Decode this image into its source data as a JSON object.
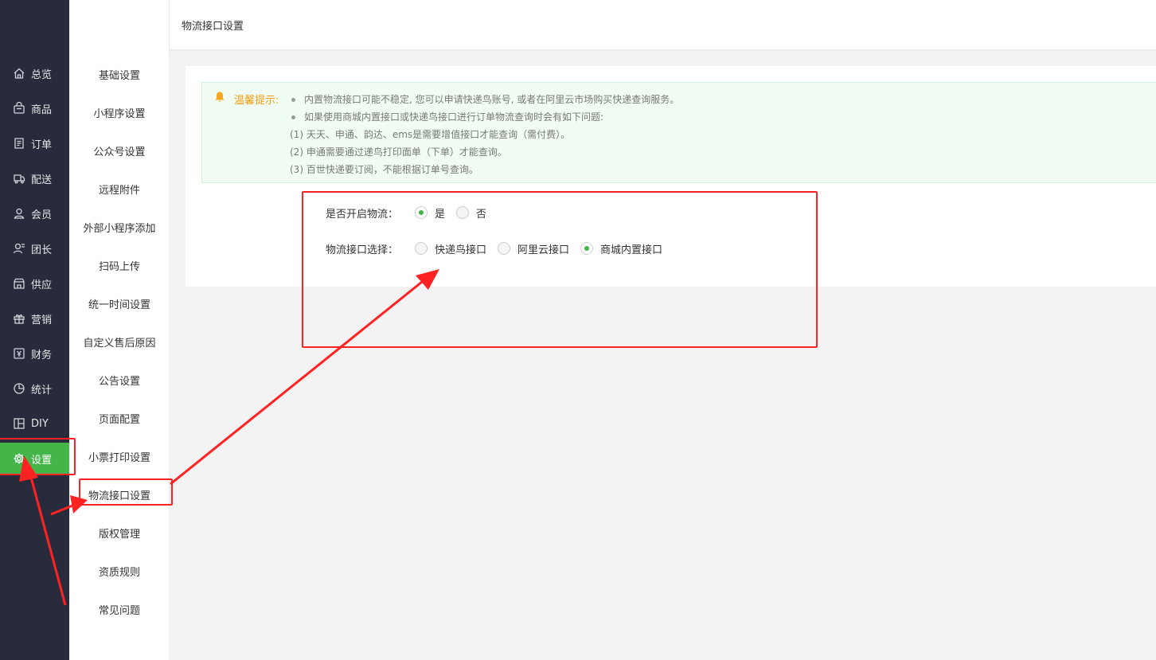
{
  "header": {
    "title": "物流接口设置"
  },
  "nav1": {
    "items": [
      {
        "label": "总览",
        "icon": "home-icon"
      },
      {
        "label": "商品",
        "icon": "goods-icon"
      },
      {
        "label": "订单",
        "icon": "order-icon"
      },
      {
        "label": "配送",
        "icon": "delivery-icon"
      },
      {
        "label": "会员",
        "icon": "member-icon"
      },
      {
        "label": "团长",
        "icon": "leader-icon"
      },
      {
        "label": "供应",
        "icon": "supply-icon"
      },
      {
        "label": "营销",
        "icon": "gift-icon"
      },
      {
        "label": "财务",
        "icon": "finance-icon"
      },
      {
        "label": "统计",
        "icon": "pie-chart-icon"
      },
      {
        "label": "DIY",
        "icon": "layout-icon"
      },
      {
        "label": "设置",
        "icon": "gear-icon"
      }
    ],
    "active_color": "#44b549",
    "bg_color": "#282b3b"
  },
  "nav2": {
    "items": [
      "基础设置",
      "小程序设置",
      "公众号设置",
      "远程附件",
      "外部小程序添加",
      "扫码上传",
      "统一时间设置",
      "自定义售后原因",
      "公告设置",
      "页面配置",
      "小票打印设置",
      "物流接口设置",
      "版权管理",
      "资质规则",
      "常见问题"
    ]
  },
  "tip": {
    "title": "温馨提示:",
    "lines": [
      "内置物流接口可能不稳定, 您可以申请快递鸟账号, 或者在阿里云市场购买快递查询服务。",
      "如果使用商城内置接口或快递鸟接口进行订单物流查询时会有如下问题:",
      "(1) 天天、申通、韵达、ems是需要增值接口才能查询（需付费）。",
      "(2) 申通需要通过递鸟打印面单（下单）才能查询。",
      "(3) 百世快递要订阅，不能根据订单号查询。"
    ]
  },
  "form": {
    "logistics_enable": {
      "label": "是否开启物流：",
      "options": [
        "是",
        "否"
      ],
      "selected": "是"
    },
    "logistics_api": {
      "label": "物流接口选择：",
      "options": [
        "快递鸟接口",
        "阿里云接口",
        "商城内置接口"
      ],
      "selected": "商城内置接口"
    }
  },
  "annotation_color": "#ff2222"
}
